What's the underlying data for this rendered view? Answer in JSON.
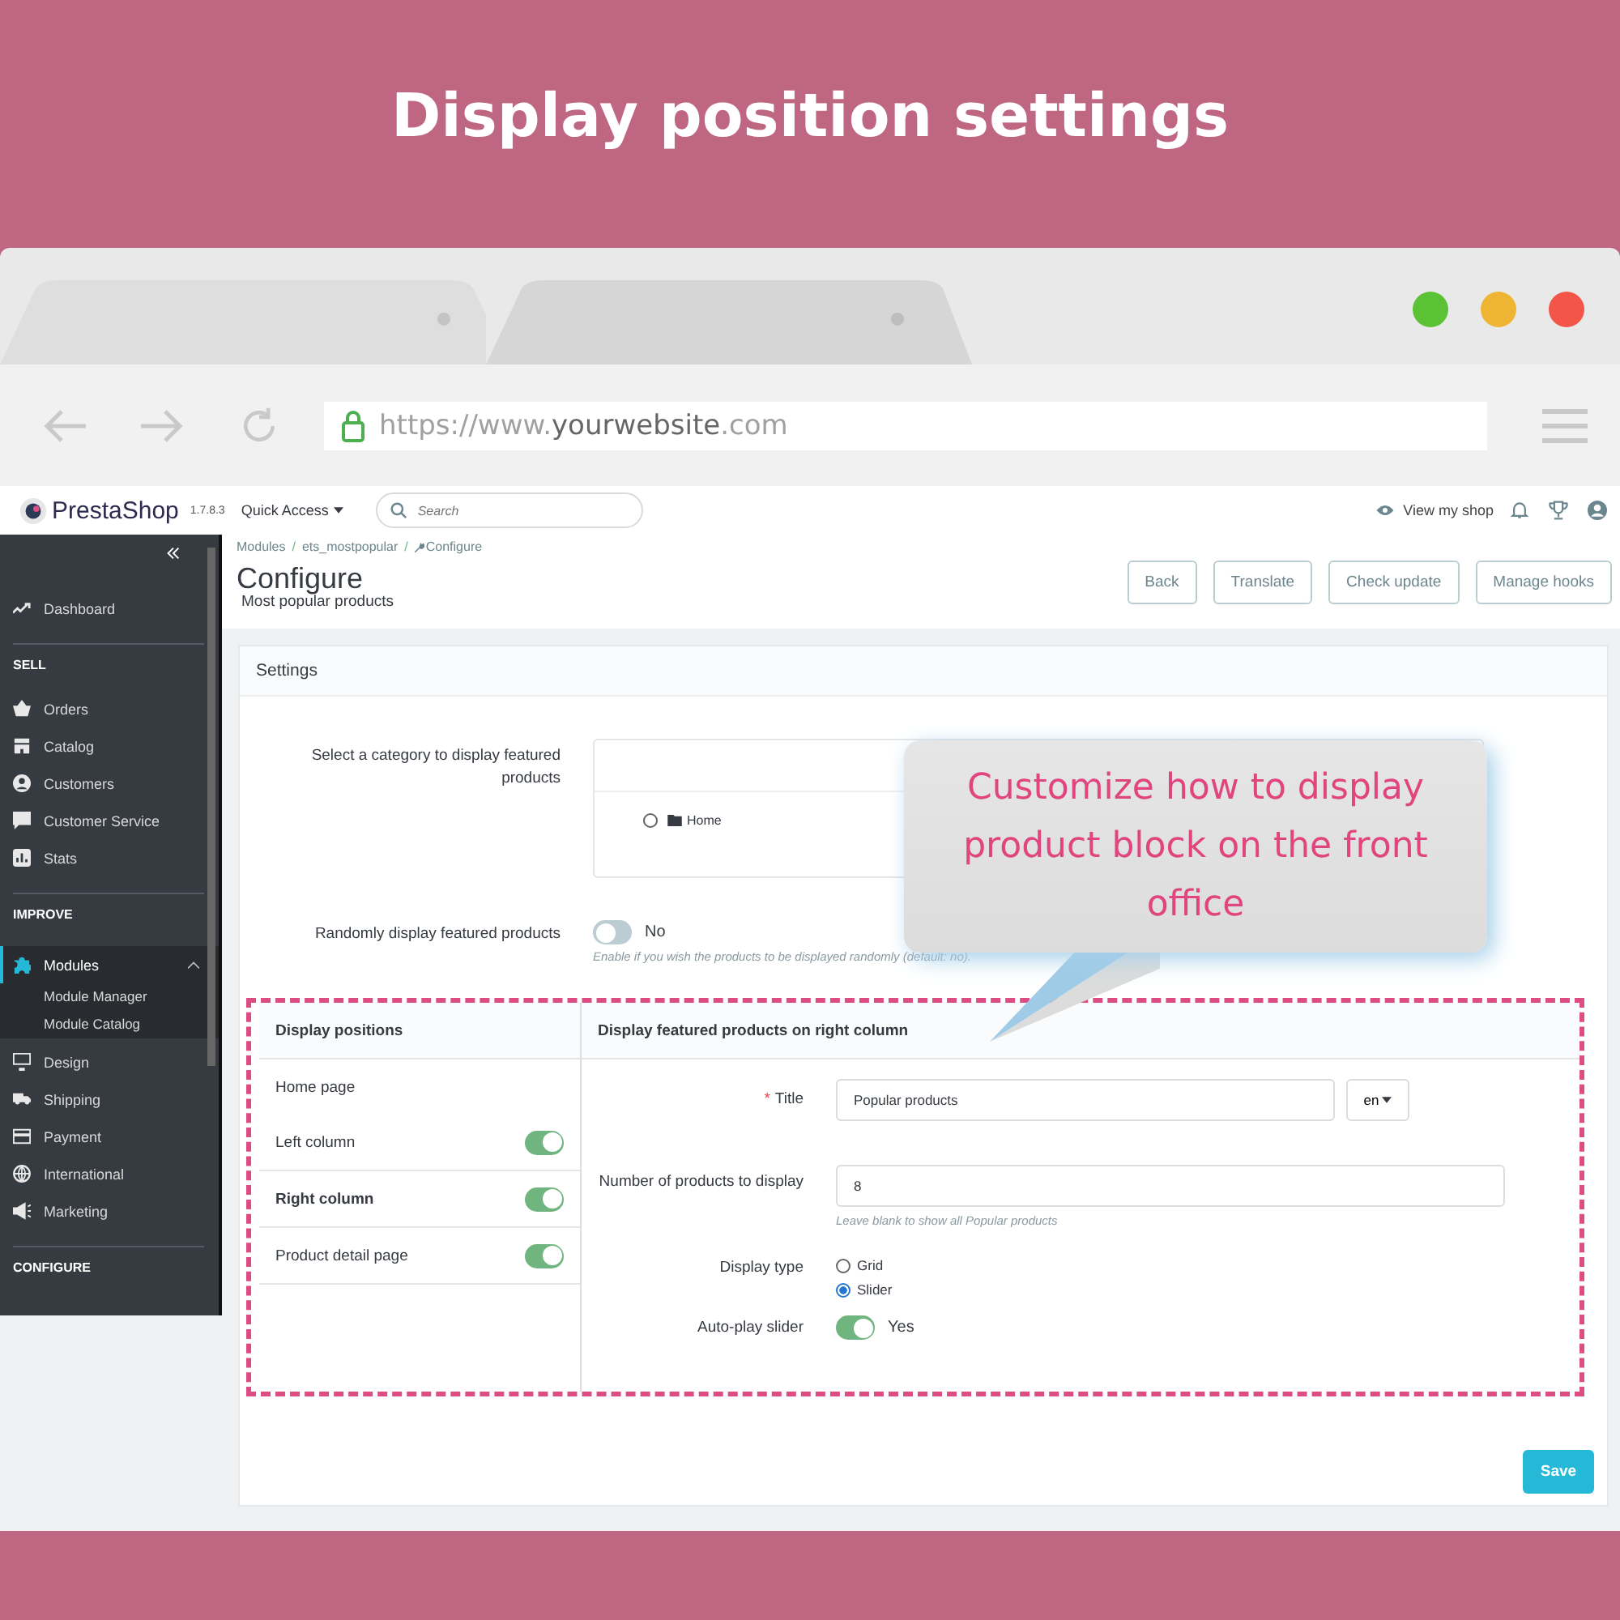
{
  "banner": {
    "title": "Display position settings"
  },
  "browser": {
    "url": {
      "scheme": "https://www.",
      "domain": "yourwebsite",
      "suffix": ".com"
    }
  },
  "header": {
    "logo": "PrestaShop",
    "version": "1.7.8.3",
    "quick_access": "Quick Access",
    "search": {
      "placeholder": "Search"
    },
    "view_shop": "View my shop"
  },
  "sidebar": {
    "items": [
      {
        "kind": "item",
        "label": "Dashboard",
        "selected": false
      },
      {
        "kind": "heading",
        "label": "SELL"
      },
      {
        "kind": "item",
        "label": "Orders",
        "selected": false
      },
      {
        "kind": "item",
        "label": "Catalog",
        "selected": false
      },
      {
        "kind": "item",
        "label": "Customers",
        "selected": false
      },
      {
        "kind": "item",
        "label": "Customer Service",
        "selected": false
      },
      {
        "kind": "item",
        "label": "Stats",
        "selected": false
      },
      {
        "kind": "heading",
        "label": "IMPROVE"
      },
      {
        "kind": "item",
        "label": "Modules",
        "selected": true,
        "expanded": true
      },
      {
        "kind": "subitem",
        "label": "Module Manager",
        "selected": false
      },
      {
        "kind": "subitem",
        "label": "Module Catalog",
        "selected": false
      },
      {
        "kind": "item",
        "label": "Design",
        "selected": false
      },
      {
        "kind": "item",
        "label": "Shipping",
        "selected": false
      },
      {
        "kind": "item",
        "label": "Payment",
        "selected": false
      },
      {
        "kind": "item",
        "label": "International",
        "selected": false
      },
      {
        "kind": "item",
        "label": "Marketing",
        "selected": false
      },
      {
        "kind": "heading",
        "label": "CONFIGURE"
      }
    ]
  },
  "page": {
    "breadcrumbs": [
      "Modules",
      "ets_mostpopular",
      "Configure"
    ],
    "breadcrumb_separator": "/",
    "title": "Configure",
    "subtitle": "Most popular products",
    "buttons": [
      "Back",
      "Translate",
      "Check update",
      "Manage hooks"
    ]
  },
  "settings": {
    "title": "Settings",
    "category": {
      "label": "Select a category to display featured products",
      "tree": [
        {
          "label": "Home",
          "selected": false
        }
      ]
    },
    "random": {
      "label": "Randomly display featured products",
      "on": false,
      "state_label": "No",
      "hint": "Enable if you wish the products to be displayed randomly (default: no)."
    },
    "positions": {
      "title": "Display positions",
      "items": [
        {
          "kind": "plain",
          "label": "Home page",
          "selected": false
        },
        {
          "kind": "toggle",
          "label": "Left column",
          "selected": false,
          "on": true
        },
        {
          "kind": "toggle",
          "label": "Right column",
          "selected": true,
          "on": true
        },
        {
          "kind": "toggle",
          "label": "Product detail page",
          "selected": false,
          "on": true
        }
      ]
    },
    "detail": {
      "title": "Display featured products on right column",
      "title_field": {
        "label": "Title",
        "required_mark": "*",
        "value": "Popular products",
        "language": "en"
      },
      "count_field": {
        "label": "Number of products to display",
        "value": "8",
        "hint": "Leave blank to show all Popular products"
      },
      "display_type": {
        "label": "Display type",
        "options": [
          {
            "label": "Grid",
            "selected": false
          },
          {
            "label": "Slider",
            "selected": true
          }
        ]
      },
      "autoplay": {
        "label": "Auto-play slider",
        "on": true,
        "state_label": "Yes"
      }
    },
    "save": "Save"
  },
  "callout": {
    "text": "Customize how to display product block on the front office"
  }
}
